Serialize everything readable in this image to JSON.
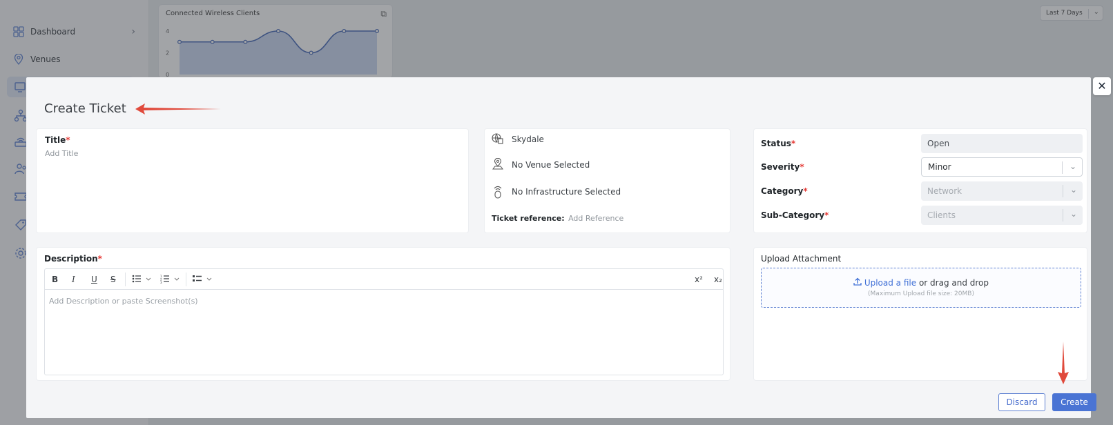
{
  "sidebar": {
    "items": [
      {
        "label": "Dashboard",
        "icon": "dashboard-icon"
      },
      {
        "label": "Venues",
        "icon": "location-pin-icon"
      }
    ],
    "collapsed_icons": [
      "devices-icon",
      "topology-icon",
      "router-icon",
      "users-icon",
      "ticket-icon",
      "tag-icon",
      "settings-icon"
    ]
  },
  "background": {
    "card_title": "Connected Wireless Clients",
    "range_select": "Last 7 Days",
    "chart_ticks": [
      "4",
      "2",
      "0"
    ]
  },
  "chart_data": {
    "type": "area",
    "title": "Connected Wireless Clients",
    "y_ticks": [
      0,
      2,
      4
    ],
    "ylim": [
      0,
      4
    ],
    "values": [
      3,
      3,
      3,
      4,
      2,
      4,
      4
    ],
    "grid": false
  },
  "modal": {
    "title": "Create Ticket",
    "title_field": {
      "label": "Title",
      "placeholder": "Add Title"
    },
    "meta": {
      "organization": "Skydale",
      "venue": "No Venue Selected",
      "infrastructure": "No Infrastructure Selected",
      "reference_label": "Ticket reference:",
      "reference_placeholder": "Add Reference"
    },
    "status_fields": [
      {
        "label": "Status",
        "value": "Open"
      },
      {
        "label": "Severity",
        "value": "Minor"
      },
      {
        "label": "Category",
        "value": "Network"
      },
      {
        "label": "Sub-Category",
        "value": "Clients"
      }
    ],
    "description": {
      "label": "Description",
      "placeholder": "Add Description or paste Screenshot(s)",
      "toolbar": {
        "bold": "B",
        "italic": "I",
        "underline": "U",
        "strike": "S",
        "superscript": "x²",
        "subscript": "x₂"
      }
    },
    "upload": {
      "label": "Upload Attachment",
      "link": "Upload a file",
      "text": "or drag and drop",
      "hint": "(Maximum Upload file size: 20MB)"
    },
    "buttons": {
      "discard": "Discard",
      "create": "Create",
      "close": "✕"
    },
    "required_mark": "*"
  },
  "colors": {
    "accent": "#4a74d4",
    "required": "#e53935",
    "annotation_arrow": "#e04a3c"
  }
}
